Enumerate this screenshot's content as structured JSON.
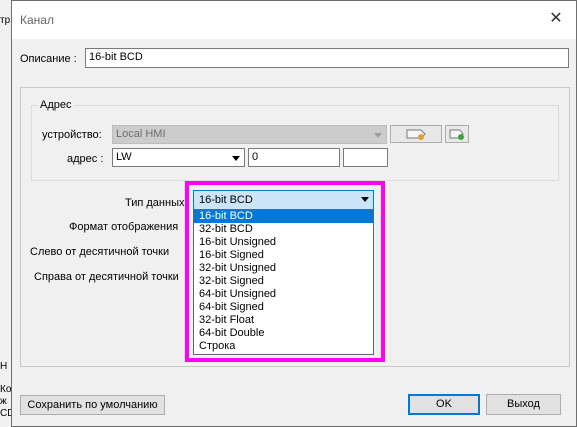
{
  "background": {
    "partial_left_top": "тр",
    "partial_left_side": "Н",
    "partial_left_bottom": [
      "Ко",
      "ж",
      "CD"
    ]
  },
  "dialog": {
    "title": "Канал",
    "description": {
      "label": "Описание :",
      "value": "16-bit BCD"
    },
    "address_group": {
      "legend": "Адрес",
      "device": {
        "label": "устройство:",
        "value": "Local HMI"
      },
      "address": {
        "label": "адрес :",
        "type_value": "LW",
        "number_value": "0",
        "extra_value": ""
      }
    },
    "data_type": {
      "label": "Тип данных",
      "selected": "16-bit BCD",
      "options": [
        "16-bit BCD",
        "32-bit BCD",
        "16-bit Unsigned",
        "16-bit Signed",
        "32-bit Unsigned",
        "32-bit Signed",
        "64-bit Unsigned",
        "64-bit Signed",
        "32-bit Float",
        "64-bit Double",
        "Строка"
      ]
    },
    "display_format": {
      "label": "Формат отображения"
    },
    "left_decimal": {
      "label": "Слево от десятичной точки"
    },
    "right_decimal": {
      "label": "Справа от десятичной точки"
    },
    "buttons": {
      "save_default": "Сохранить по умолчанию",
      "ok": "OK",
      "exit": "Выход"
    }
  },
  "colors": {
    "highlight": "#ff00ff",
    "selection": "#0078d7"
  }
}
